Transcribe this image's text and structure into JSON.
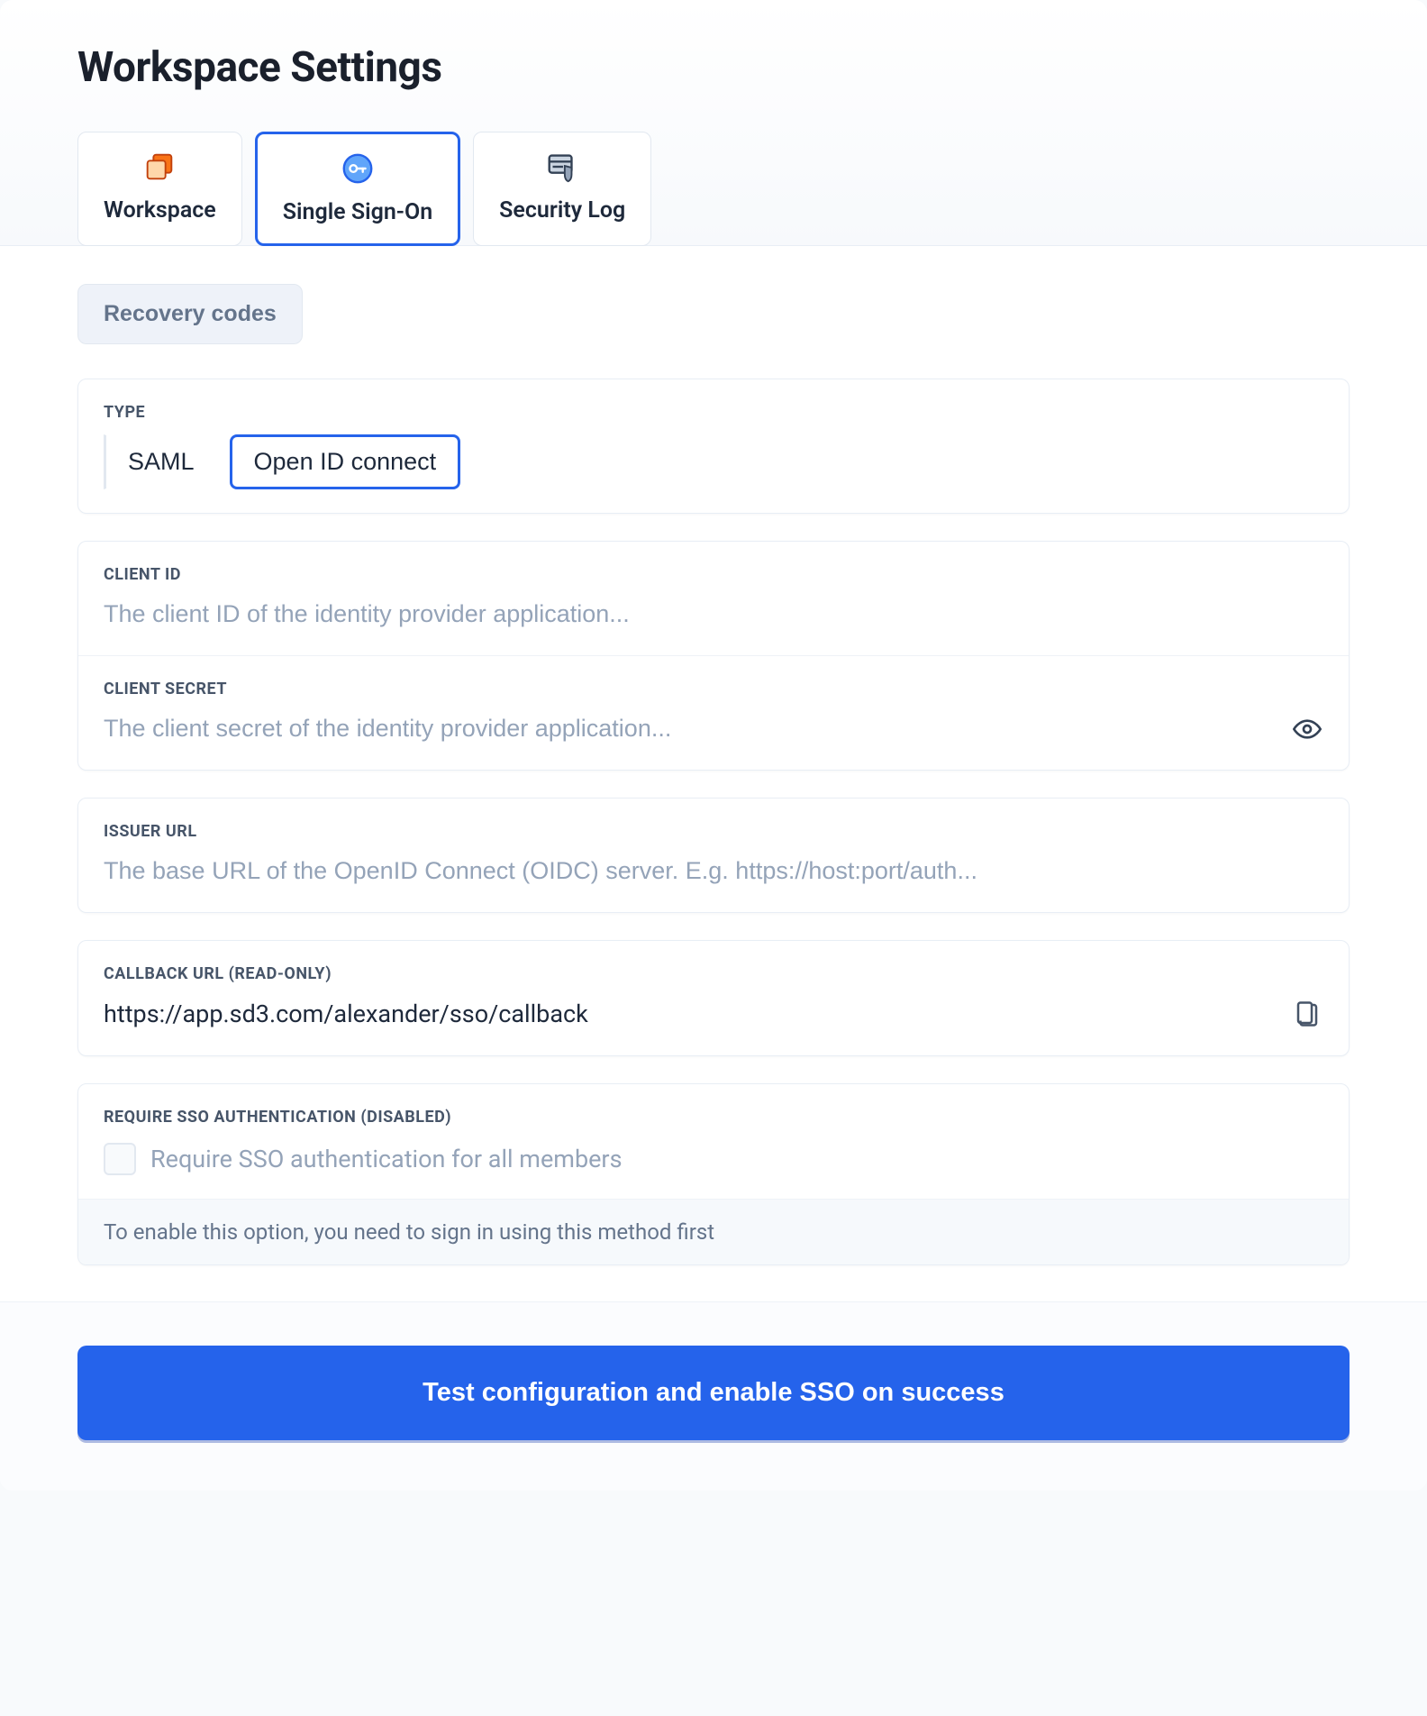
{
  "header": {
    "title": "Workspace Settings"
  },
  "tabs": [
    {
      "label": "Workspace"
    },
    {
      "label": "Single Sign-On"
    },
    {
      "label": "Security Log"
    }
  ],
  "recovery": {
    "label": "Recovery codes"
  },
  "sections": {
    "type": {
      "label": "TYPE",
      "options": [
        {
          "label": "SAML",
          "active": false
        },
        {
          "label": "Open ID connect",
          "active": true
        }
      ]
    },
    "clientId": {
      "label": "CLIENT ID",
      "placeholder": "The client ID of the identity provider application...",
      "value": ""
    },
    "clientSecret": {
      "label": "CLIENT SECRET",
      "placeholder": "The client secret of the identity provider application...",
      "value": ""
    },
    "issuerUrl": {
      "label": "ISSUER URL",
      "placeholder": "The base URL of the OpenID Connect (OIDC) server. E.g. https://host:port/auth...",
      "value": ""
    },
    "callbackUrl": {
      "label": "CALLBACK URL (READ-ONLY)",
      "value": "https://app.sd3.com/alexander/sso/callback"
    },
    "requireSso": {
      "label": "REQUIRE SSO AUTHENTICATION (DISABLED)",
      "checkboxLabel": "Require SSO authentication for all members",
      "note": "To enable this option, you need to sign in using this method first"
    }
  },
  "footer": {
    "primaryButton": "Test configuration and enable SSO on success"
  },
  "colors": {
    "accent": "#2563eb",
    "muted": "#94a3b8",
    "text": "#1e293b"
  }
}
